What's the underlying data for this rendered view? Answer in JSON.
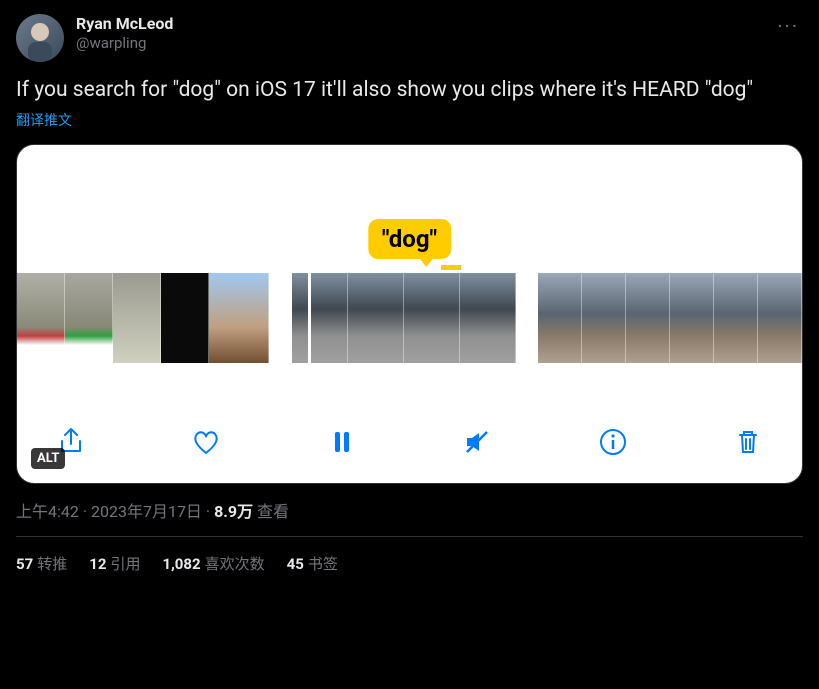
{
  "author": {
    "display_name": "Ryan McLeod",
    "handle": "@warpling"
  },
  "tweet_text": "If you search for \"dog\" on iOS 17 it'll also show you clips where it's HEARD \"dog\"",
  "translate_label": "翻译推文",
  "media": {
    "caption_text": "\"dog\"",
    "alt_badge": "ALT"
  },
  "meta": {
    "time": "上午4:42",
    "date": "2023年7月17日",
    "separator": " · ",
    "views_count": "8.9万",
    "views_label": " 查看"
  },
  "stats": {
    "retweets": {
      "count": "57",
      "label": "转推"
    },
    "quotes": {
      "count": "12",
      "label": "引用"
    },
    "likes": {
      "count": "1,082",
      "label": "喜欢次数"
    },
    "bookmarks": {
      "count": "45",
      "label": "书签"
    }
  }
}
